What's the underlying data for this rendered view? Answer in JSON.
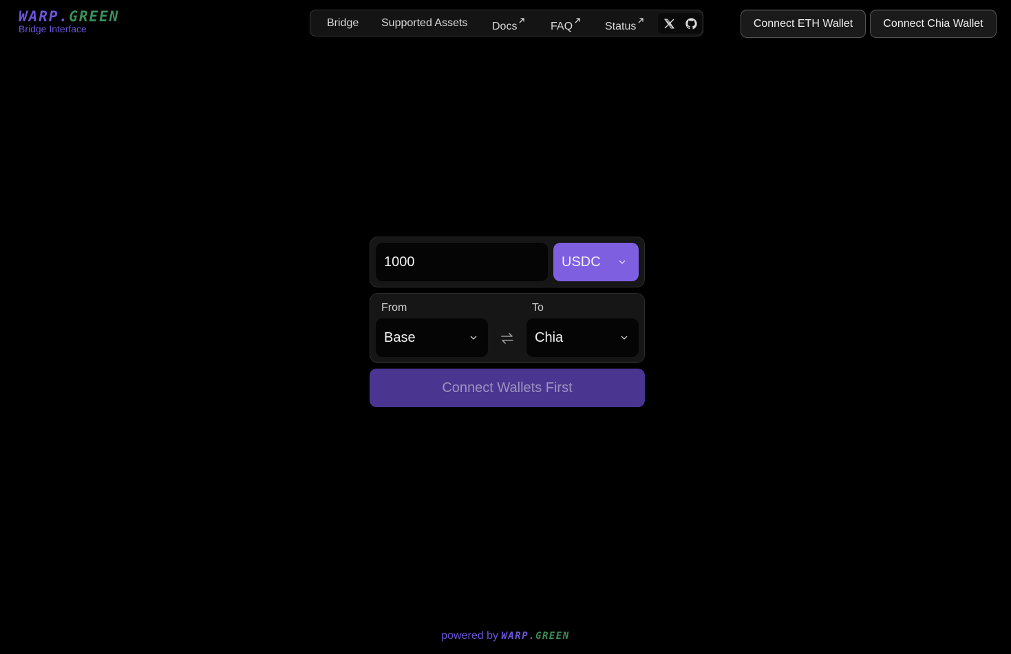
{
  "brand": {
    "logo_part1": "WARP.",
    "logo_part2": "GREEN",
    "subtitle": "Bridge Interface",
    "color_primary": "#6d54d9",
    "color_secondary": "#3b8f5a"
  },
  "nav": {
    "items": [
      {
        "label": "Bridge",
        "external": false
      },
      {
        "label": "Supported Assets",
        "external": false
      },
      {
        "label": "Docs",
        "external": true
      },
      {
        "label": "FAQ",
        "external": true
      },
      {
        "label": "Status",
        "external": true
      }
    ],
    "social": [
      "x-icon",
      "github-icon"
    ]
  },
  "wallets": {
    "eth_label": "Connect ETH Wallet",
    "chia_label": "Connect Chia Wallet"
  },
  "bridge": {
    "amount": "1000",
    "asset": "USDC",
    "from_label": "From",
    "to_label": "To",
    "from_chain": "Base",
    "to_chain": "Chia",
    "action_label": "Connect Wallets First",
    "accent_color": "#7d5fe0"
  },
  "footer": {
    "prefix": "powered by",
    "brand_part1": "WARP.",
    "brand_part2": "GREEN"
  }
}
